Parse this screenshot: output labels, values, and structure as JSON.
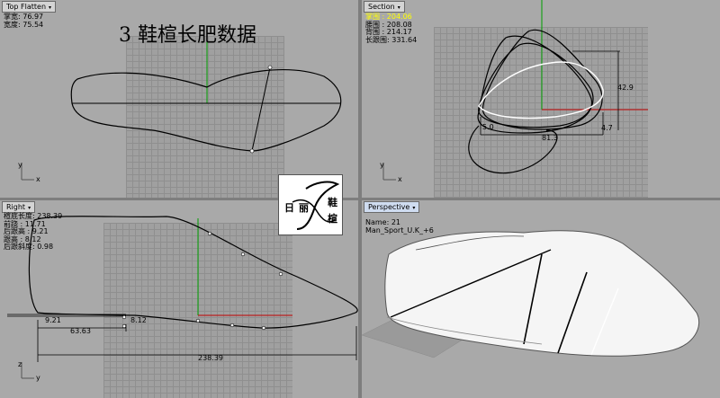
{
  "title": "3  鞋楦长肥数据",
  "viewports": {
    "top": {
      "label": "Top Flatten",
      "info": [
        "掌宽: 76.97",
        "宽度: 75.54"
      ]
    },
    "section": {
      "label": "Section",
      "highlight": "掌围 : 204.06",
      "info": [
        "腰围 : 208.08",
        "背围 : 214.17",
        "长跟围: 331.64"
      ],
      "dims": [
        "42.9",
        "5.0",
        "81.3",
        "4.7"
      ]
    },
    "right": {
      "label": "Right",
      "info": [
        "楦底长度: 238.39",
        "前跷 : 11.71",
        "后跟高 : 9.21",
        "跟高 : 8.12",
        "后跟斜度: 0.98"
      ],
      "dims": [
        "9.21",
        "8.12",
        "63.63",
        "238.39"
      ]
    },
    "perspective": {
      "label": "Perspective",
      "info": [
        "Name: 21",
        "Man_Sport_U.K_+6"
      ]
    }
  },
  "logo": {
    "chars": [
      "日",
      "丽",
      "鞋",
      "楦"
    ]
  },
  "colors": {
    "viewport_bg": "#a9a9a9",
    "highlight_text": "#ffff00",
    "axis_red": "#c00000",
    "axis_green": "#00a000"
  }
}
